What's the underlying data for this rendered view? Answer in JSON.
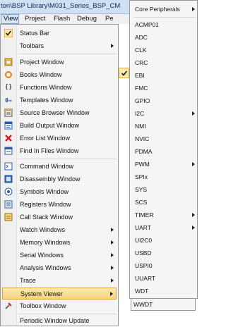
{
  "window": {
    "title_path": "ton\\BSP Library\\M031_Series_BSP_CM"
  },
  "menubar": [
    "View",
    "Project",
    "Flash",
    "Debug",
    "Pe"
  ],
  "menu": {
    "status_bar": "Status Bar",
    "toolbars": "Toolbars",
    "project_window": "Project Window",
    "books_window": "Books Window",
    "functions_window": "Functions Window",
    "templates_window": "Templates Window",
    "source_browser_window": "Source Browser Window",
    "build_output_window": "Build Output Window",
    "error_list_window": "Error List Window",
    "find_in_files_window": "Find In Files Window",
    "command_window": "Command Window",
    "disassembly_window": "Disassembly Window",
    "symbols_window": "Symbols Window",
    "registers_window": "Registers Window",
    "call_stack_window": "Call Stack Window",
    "watch_windows": "Watch Windows",
    "memory_windows": "Memory Windows",
    "serial_windows": "Serial Windows",
    "analysis_windows": "Analysis Windows",
    "trace": "Trace",
    "system_viewer": "System Viewer",
    "toolbox_window": "Toolbox Window",
    "periodic_update": "Periodic Window Update"
  },
  "submenu": [
    "Core Peripherals",
    "ACMP01",
    "ADC",
    "CLK",
    "CRC",
    "EBI",
    "FMC",
    "GPIO",
    "I2C",
    "NMI",
    "NVIC",
    "PDMA",
    "PWM",
    "SPIx",
    "SYS",
    "SCS",
    "TIMER",
    "UART",
    "UI2C0",
    "USBD",
    "USPI0",
    "UUART",
    "WDT",
    "WWDT"
  ],
  "colors": {
    "highlight": "#f7d27a",
    "title_bg": "#cfe0f3",
    "menu_bg": "#f5f5f5"
  }
}
